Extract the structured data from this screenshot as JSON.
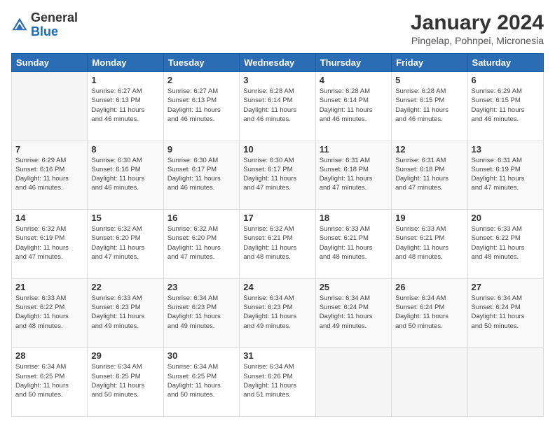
{
  "logo": {
    "general": "General",
    "blue": "Blue"
  },
  "header": {
    "title": "January 2024",
    "subtitle": "Pingelap, Pohnpei, Micronesia"
  },
  "calendar": {
    "days_of_week": [
      "Sunday",
      "Monday",
      "Tuesday",
      "Wednesday",
      "Thursday",
      "Friday",
      "Saturday"
    ],
    "weeks": [
      [
        {
          "day": "",
          "info": ""
        },
        {
          "day": "1",
          "info": "Sunrise: 6:27 AM\nSunset: 6:13 PM\nDaylight: 11 hours\nand 46 minutes."
        },
        {
          "day": "2",
          "info": "Sunrise: 6:27 AM\nSunset: 6:13 PM\nDaylight: 11 hours\nand 46 minutes."
        },
        {
          "day": "3",
          "info": "Sunrise: 6:28 AM\nSunset: 6:14 PM\nDaylight: 11 hours\nand 46 minutes."
        },
        {
          "day": "4",
          "info": "Sunrise: 6:28 AM\nSunset: 6:14 PM\nDaylight: 11 hours\nand 46 minutes."
        },
        {
          "day": "5",
          "info": "Sunrise: 6:28 AM\nSunset: 6:15 PM\nDaylight: 11 hours\nand 46 minutes."
        },
        {
          "day": "6",
          "info": "Sunrise: 6:29 AM\nSunset: 6:15 PM\nDaylight: 11 hours\nand 46 minutes."
        }
      ],
      [
        {
          "day": "7",
          "info": "Sunrise: 6:29 AM\nSunset: 6:16 PM\nDaylight: 11 hours\nand 46 minutes."
        },
        {
          "day": "8",
          "info": "Sunrise: 6:30 AM\nSunset: 6:16 PM\nDaylight: 11 hours\nand 46 minutes."
        },
        {
          "day": "9",
          "info": "Sunrise: 6:30 AM\nSunset: 6:17 PM\nDaylight: 11 hours\nand 46 minutes."
        },
        {
          "day": "10",
          "info": "Sunrise: 6:30 AM\nSunset: 6:17 PM\nDaylight: 11 hours\nand 47 minutes."
        },
        {
          "day": "11",
          "info": "Sunrise: 6:31 AM\nSunset: 6:18 PM\nDaylight: 11 hours\nand 47 minutes."
        },
        {
          "day": "12",
          "info": "Sunrise: 6:31 AM\nSunset: 6:18 PM\nDaylight: 11 hours\nand 47 minutes."
        },
        {
          "day": "13",
          "info": "Sunrise: 6:31 AM\nSunset: 6:19 PM\nDaylight: 11 hours\nand 47 minutes."
        }
      ],
      [
        {
          "day": "14",
          "info": "Sunrise: 6:32 AM\nSunset: 6:19 PM\nDaylight: 11 hours\nand 47 minutes."
        },
        {
          "day": "15",
          "info": "Sunrise: 6:32 AM\nSunset: 6:20 PM\nDaylight: 11 hours\nand 47 minutes."
        },
        {
          "day": "16",
          "info": "Sunrise: 6:32 AM\nSunset: 6:20 PM\nDaylight: 11 hours\nand 47 minutes."
        },
        {
          "day": "17",
          "info": "Sunrise: 6:32 AM\nSunset: 6:21 PM\nDaylight: 11 hours\nand 48 minutes."
        },
        {
          "day": "18",
          "info": "Sunrise: 6:33 AM\nSunset: 6:21 PM\nDaylight: 11 hours\nand 48 minutes."
        },
        {
          "day": "19",
          "info": "Sunrise: 6:33 AM\nSunset: 6:21 PM\nDaylight: 11 hours\nand 48 minutes."
        },
        {
          "day": "20",
          "info": "Sunrise: 6:33 AM\nSunset: 6:22 PM\nDaylight: 11 hours\nand 48 minutes."
        }
      ],
      [
        {
          "day": "21",
          "info": "Sunrise: 6:33 AM\nSunset: 6:22 PM\nDaylight: 11 hours\nand 48 minutes."
        },
        {
          "day": "22",
          "info": "Sunrise: 6:33 AM\nSunset: 6:23 PM\nDaylight: 11 hours\nand 49 minutes."
        },
        {
          "day": "23",
          "info": "Sunrise: 6:34 AM\nSunset: 6:23 PM\nDaylight: 11 hours\nand 49 minutes."
        },
        {
          "day": "24",
          "info": "Sunrise: 6:34 AM\nSunset: 6:23 PM\nDaylight: 11 hours\nand 49 minutes."
        },
        {
          "day": "25",
          "info": "Sunrise: 6:34 AM\nSunset: 6:24 PM\nDaylight: 11 hours\nand 49 minutes."
        },
        {
          "day": "26",
          "info": "Sunrise: 6:34 AM\nSunset: 6:24 PM\nDaylight: 11 hours\nand 50 minutes."
        },
        {
          "day": "27",
          "info": "Sunrise: 6:34 AM\nSunset: 6:24 PM\nDaylight: 11 hours\nand 50 minutes."
        }
      ],
      [
        {
          "day": "28",
          "info": "Sunrise: 6:34 AM\nSunset: 6:25 PM\nDaylight: 11 hours\nand 50 minutes."
        },
        {
          "day": "29",
          "info": "Sunrise: 6:34 AM\nSunset: 6:25 PM\nDaylight: 11 hours\nand 50 minutes."
        },
        {
          "day": "30",
          "info": "Sunrise: 6:34 AM\nSunset: 6:25 PM\nDaylight: 11 hours\nand 50 minutes."
        },
        {
          "day": "31",
          "info": "Sunrise: 6:34 AM\nSunset: 6:26 PM\nDaylight: 11 hours\nand 51 minutes."
        },
        {
          "day": "",
          "info": ""
        },
        {
          "day": "",
          "info": ""
        },
        {
          "day": "",
          "info": ""
        }
      ]
    ]
  }
}
